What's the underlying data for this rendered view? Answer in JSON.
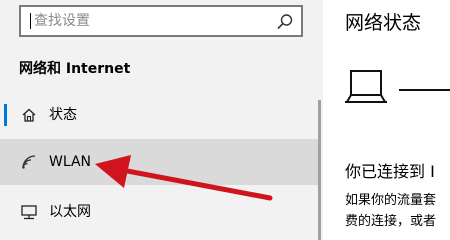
{
  "search": {
    "placeholder": "查找设置",
    "icon": "search-icon"
  },
  "sidebar": {
    "section_title": "网络和 Internet",
    "items": [
      {
        "label": "状态",
        "icon": "home-icon",
        "selected": true
      },
      {
        "label": "WLAN",
        "icon": "wifi-icon",
        "hovered": true
      },
      {
        "label": "以太网",
        "icon": "ethernet-icon"
      }
    ]
  },
  "content": {
    "title": "网络状态",
    "heading": "你已连接到 I",
    "description_lines": [
      "如果你的流量套",
      "费的连接，或者"
    ]
  },
  "colors": {
    "accent": "#0078d7",
    "annotation_arrow": "#d0141d",
    "sidebar_bg": "#f2f2f2",
    "hover_bg": "#dadada"
  }
}
